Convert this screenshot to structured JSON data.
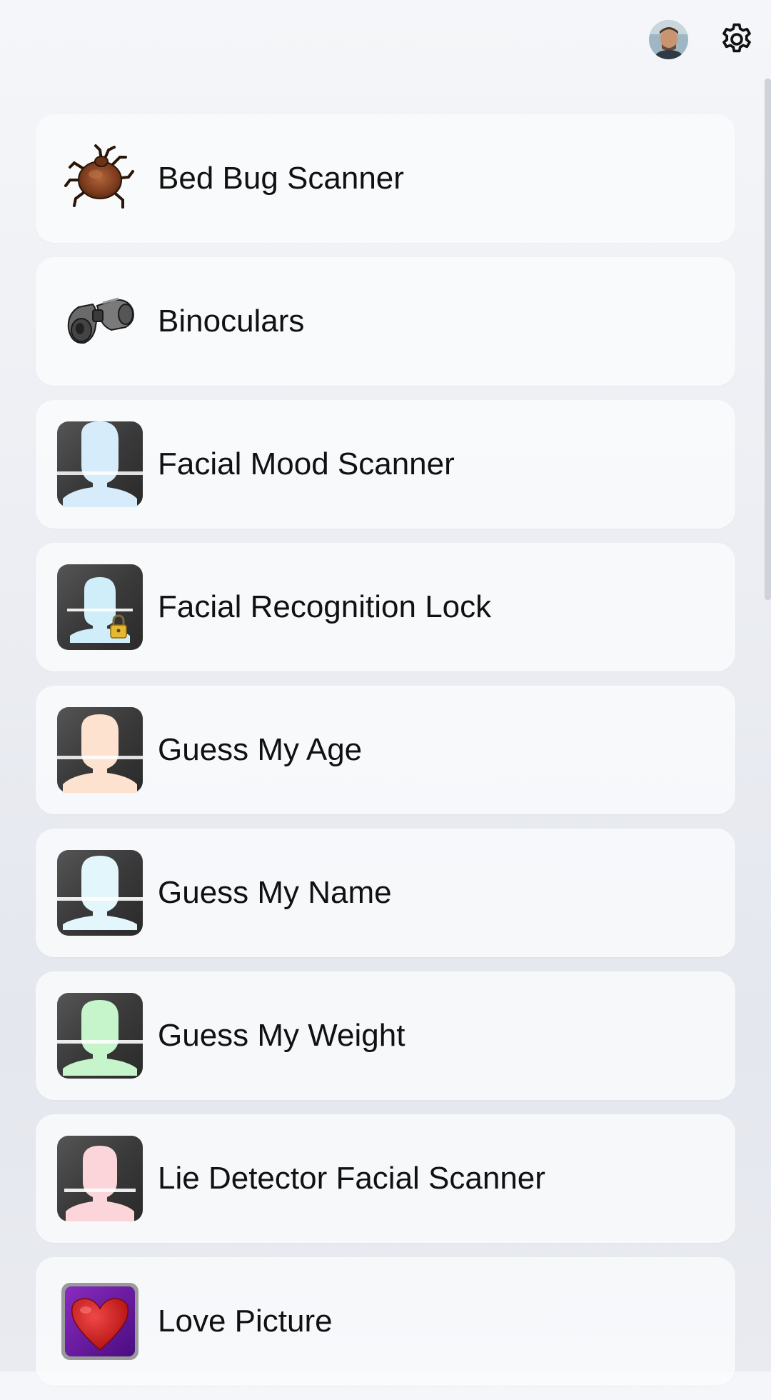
{
  "header": {
    "avatar_icon": "user-avatar",
    "settings_icon": "gear-icon"
  },
  "apps": [
    {
      "label": "Bed Bug Scanner",
      "icon": "bed-bug-icon"
    },
    {
      "label": "Binoculars",
      "icon": "binoculars-icon"
    },
    {
      "label": "Facial Mood Scanner",
      "icon": "face-scanner-blue-icon"
    },
    {
      "label": "Facial Recognition Lock",
      "icon": "face-lock-icon"
    },
    {
      "label": "Guess My Age",
      "icon": "face-scanner-peach-icon"
    },
    {
      "label": "Guess My Name",
      "icon": "face-scanner-ice-icon"
    },
    {
      "label": "Guess My Weight",
      "icon": "face-scanner-green-icon"
    },
    {
      "label": "Lie Detector Facial Scanner",
      "icon": "face-scanner-pink-icon"
    },
    {
      "label": "Love Picture",
      "icon": "heart-icon"
    }
  ],
  "colors": {
    "mood_head": "#d7ecfb",
    "lock_head": "#cfeef9",
    "age_head": "#fde3cf",
    "name_head": "#e2f6fb",
    "weight_head": "#c6f5cc",
    "lie_head": "#fbd5da",
    "love_bg": "#6a1aa0",
    "heart": "#d42222"
  }
}
